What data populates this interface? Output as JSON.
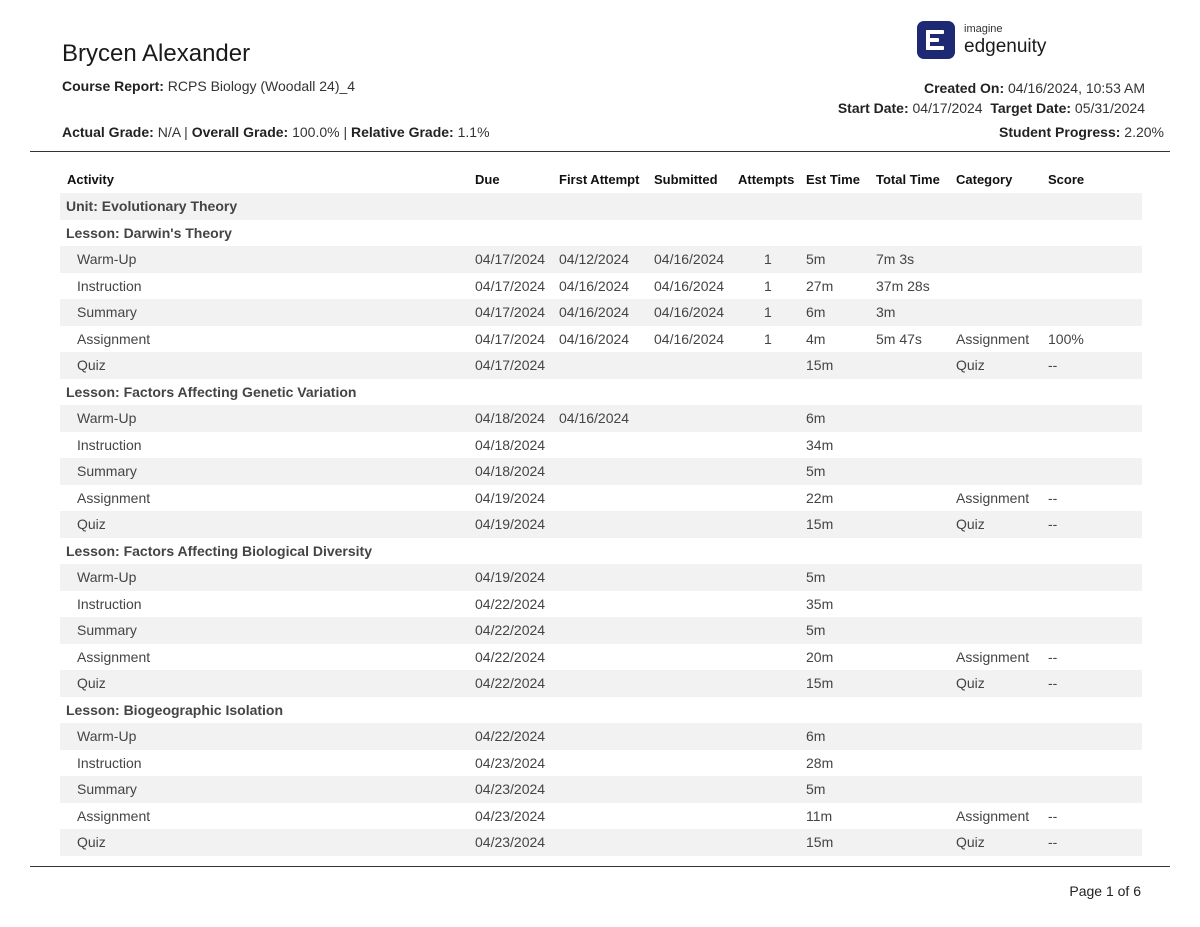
{
  "header": {
    "student_name": "Brycen Alexander",
    "course_report_label": "Course Report:",
    "course_name": "RCPS Biology (Woodall 24)_4",
    "actual_grade_label": "Actual Grade:",
    "actual_grade": "N/A",
    "overall_grade_label": "Overall Grade:",
    "overall_grade": "100.0%",
    "relative_grade_label": "Relative Grade:",
    "relative_grade": "1.1%",
    "created_on_label": "Created On:",
    "created_on": "04/16/2024, 10:53 AM",
    "start_date_label": "Start Date:",
    "start_date": "04/17/2024",
    "target_date_label": "Target Date:",
    "target_date": "05/31/2024",
    "student_progress_label": "Student Progress:",
    "student_progress": "2.20%",
    "separator": "|"
  },
  "logo": {
    "small_text": "imagine",
    "big_text": "edgenuity",
    "brand_color": "#1d2a73"
  },
  "table": {
    "columns": {
      "activity": "Activity",
      "due": "Due",
      "first_attempt": "First Attempt",
      "submitted": "Submitted",
      "attempts": "Attempts",
      "est_time": "Est Time",
      "total_time": "Total Time",
      "category": "Category",
      "score": "Score"
    },
    "unit": "Unit: Evolutionary Theory",
    "lessons": [
      {
        "title": "Lesson: Darwin's Theory",
        "activities": [
          {
            "name": "Warm-Up",
            "due": "04/17/2024",
            "first_attempt": "04/12/2024",
            "submitted": "04/16/2024",
            "attempts": "1",
            "est": "5m",
            "total": "7m 3s",
            "category": "",
            "score": ""
          },
          {
            "name": "Instruction",
            "due": "04/17/2024",
            "first_attempt": "04/16/2024",
            "submitted": "04/16/2024",
            "attempts": "1",
            "est": "27m",
            "total": "37m 28s",
            "category": "",
            "score": ""
          },
          {
            "name": "Summary",
            "due": "04/17/2024",
            "first_attempt": "04/16/2024",
            "submitted": "04/16/2024",
            "attempts": "1",
            "est": "6m",
            "total": "3m",
            "category": "",
            "score": ""
          },
          {
            "name": "Assignment",
            "due": "04/17/2024",
            "first_attempt": "04/16/2024",
            "submitted": "04/16/2024",
            "attempts": "1",
            "est": "4m",
            "total": "5m 47s",
            "category": "Assignment",
            "score": "100%"
          },
          {
            "name": "Quiz",
            "due": "04/17/2024",
            "first_attempt": "",
            "submitted": "",
            "attempts": "",
            "est": "15m",
            "total": "",
            "category": "Quiz",
            "score": "--"
          }
        ]
      },
      {
        "title": "Lesson: Factors Affecting Genetic Variation",
        "activities": [
          {
            "name": "Warm-Up",
            "due": "04/18/2024",
            "first_attempt": "04/16/2024",
            "submitted": "",
            "attempts": "",
            "est": "6m",
            "total": "",
            "category": "",
            "score": ""
          },
          {
            "name": "Instruction",
            "due": "04/18/2024",
            "first_attempt": "",
            "submitted": "",
            "attempts": "",
            "est": "34m",
            "total": "",
            "category": "",
            "score": ""
          },
          {
            "name": "Summary",
            "due": "04/18/2024",
            "first_attempt": "",
            "submitted": "",
            "attempts": "",
            "est": "5m",
            "total": "",
            "category": "",
            "score": ""
          },
          {
            "name": "Assignment",
            "due": "04/19/2024",
            "first_attempt": "",
            "submitted": "",
            "attempts": "",
            "est": "22m",
            "total": "",
            "category": "Assignment",
            "score": "--"
          },
          {
            "name": "Quiz",
            "due": "04/19/2024",
            "first_attempt": "",
            "submitted": "",
            "attempts": "",
            "est": "15m",
            "total": "",
            "category": "Quiz",
            "score": "--"
          }
        ]
      },
      {
        "title": "Lesson: Factors Affecting Biological Diversity",
        "activities": [
          {
            "name": "Warm-Up",
            "due": "04/19/2024",
            "first_attempt": "",
            "submitted": "",
            "attempts": "",
            "est": "5m",
            "total": "",
            "category": "",
            "score": ""
          },
          {
            "name": "Instruction",
            "due": "04/22/2024",
            "first_attempt": "",
            "submitted": "",
            "attempts": "",
            "est": "35m",
            "total": "",
            "category": "",
            "score": ""
          },
          {
            "name": "Summary",
            "due": "04/22/2024",
            "first_attempt": "",
            "submitted": "",
            "attempts": "",
            "est": "5m",
            "total": "",
            "category": "",
            "score": ""
          },
          {
            "name": "Assignment",
            "due": "04/22/2024",
            "first_attempt": "",
            "submitted": "",
            "attempts": "",
            "est": "20m",
            "total": "",
            "category": "Assignment",
            "score": "--"
          },
          {
            "name": "Quiz",
            "due": "04/22/2024",
            "first_attempt": "",
            "submitted": "",
            "attempts": "",
            "est": "15m",
            "total": "",
            "category": "Quiz",
            "score": "--"
          }
        ]
      },
      {
        "title": "Lesson: Biogeographic Isolation",
        "activities": [
          {
            "name": "Warm-Up",
            "due": "04/22/2024",
            "first_attempt": "",
            "submitted": "",
            "attempts": "",
            "est": "6m",
            "total": "",
            "category": "",
            "score": ""
          },
          {
            "name": "Instruction",
            "due": "04/23/2024",
            "first_attempt": "",
            "submitted": "",
            "attempts": "",
            "est": "28m",
            "total": "",
            "category": "",
            "score": ""
          },
          {
            "name": "Summary",
            "due": "04/23/2024",
            "first_attempt": "",
            "submitted": "",
            "attempts": "",
            "est": "5m",
            "total": "",
            "category": "",
            "score": ""
          },
          {
            "name": "Assignment",
            "due": "04/23/2024",
            "first_attempt": "",
            "submitted": "",
            "attempts": "",
            "est": "11m",
            "total": "",
            "category": "Assignment",
            "score": "--"
          },
          {
            "name": "Quiz",
            "due": "04/23/2024",
            "first_attempt": "",
            "submitted": "",
            "attempts": "",
            "est": "15m",
            "total": "",
            "category": "Quiz",
            "score": "--"
          }
        ]
      }
    ]
  },
  "footer": {
    "page": "Page 1 of 6"
  }
}
